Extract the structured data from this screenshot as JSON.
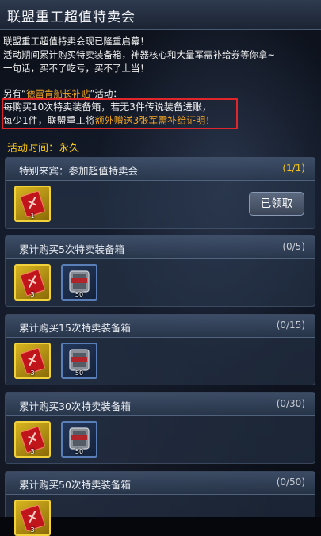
{
  "header": {
    "title": "联盟重工超值特卖会"
  },
  "description": {
    "line1": "联盟重工超值特卖会现已隆重启幕！",
    "line2": "活动期间累计购买特卖装备箱，神器核心和大量军需补给券等你拿~",
    "line3": "一句话，买不了吃亏，买不了上当！",
    "line4_pre": "另有“",
    "line4_highlight": "德雷肯船长补贴",
    "line4_post": "”活动：",
    "line5": "每购买10次特卖装备箱，若无3件传说装备进账，",
    "line6_pre": "每少1件，联盟重工将",
    "line6_highlight": "额外赠送3张军需补给证明",
    "line6_post": "！"
  },
  "activity_time": "活动时间：永久",
  "colors": {
    "accent_gold": "#f5c518",
    "highlight_orange": "#f5a623",
    "box_red": "#e0252b"
  },
  "panels": [
    {
      "title": "特别来宾：参加超值特卖会",
      "progress": "(1/1)",
      "button": "已领取",
      "items": [
        {
          "icon": "red-card-icon",
          "qty": "1"
        }
      ]
    },
    {
      "title": "累计购买5次特卖装备箱",
      "progress": "(0/5)",
      "items": [
        {
          "icon": "red-card-icon",
          "qty": "3"
        },
        {
          "icon": "supply-crate-icon",
          "qty": "50"
        }
      ]
    },
    {
      "title": "累计购买15次特卖装备箱",
      "progress": "(0/15)",
      "items": [
        {
          "icon": "red-card-icon",
          "qty": "3"
        },
        {
          "icon": "supply-crate-icon",
          "qty": "50"
        }
      ]
    },
    {
      "title": "累计购买30次特卖装备箱",
      "progress": "(0/30)",
      "items": [
        {
          "icon": "red-card-icon",
          "qty": "3"
        },
        {
          "icon": "supply-crate-icon",
          "qty": "50"
        }
      ]
    },
    {
      "title": "累计购买50次特卖装备箱",
      "progress": "(0/50)",
      "items": [
        {
          "icon": "red-card-icon",
          "qty": "3"
        }
      ]
    }
  ]
}
